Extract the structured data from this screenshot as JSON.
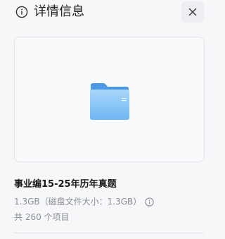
{
  "header": {
    "title": "详情信息",
    "info_icon": "info-circle-icon",
    "close_icon": "close-icon"
  },
  "preview": {
    "icon": "folder-icon",
    "folder_color": "#5aa8ee"
  },
  "details": {
    "name": "事业编15-25年历年真题",
    "size_text": "1.3GB（磁盘文件大小：1.3GB）",
    "size_info_icon": "info-circle-icon",
    "item_count": "共 260 个项目"
  }
}
